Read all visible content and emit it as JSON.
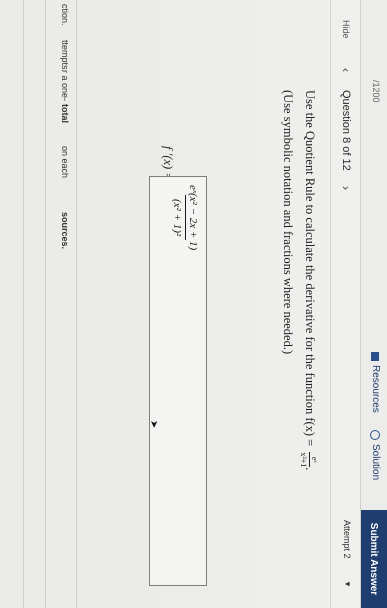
{
  "toolbar": {
    "resources_label": "Resources",
    "solution_label": "Solution",
    "submit_label": "Submit Answer"
  },
  "question": {
    "hide_label": "Hide",
    "score": "/1200",
    "title": "Question 8 of 12",
    "attempt_label": "Attempt 2",
    "instruction": "Use the Quotient Rule to calculate the derivative for the function f(x) =",
    "function_numerator": "eˣ",
    "function_denominator": "x²+1",
    "instruction_end": ".",
    "hint": "(Use symbolic notation and fractions where needed.)",
    "answer_label": "f ′(x) =",
    "answer_numerator": "eˣ(x² − 2x + 1)",
    "answer_denominator": "(x² + 1)²"
  },
  "sidebar": {
    "line1": "ction.",
    "line2": "ttempts.",
    "line3": "r a one-",
    "line4": "total",
    "line5": "on each",
    "line6": "sources."
  }
}
